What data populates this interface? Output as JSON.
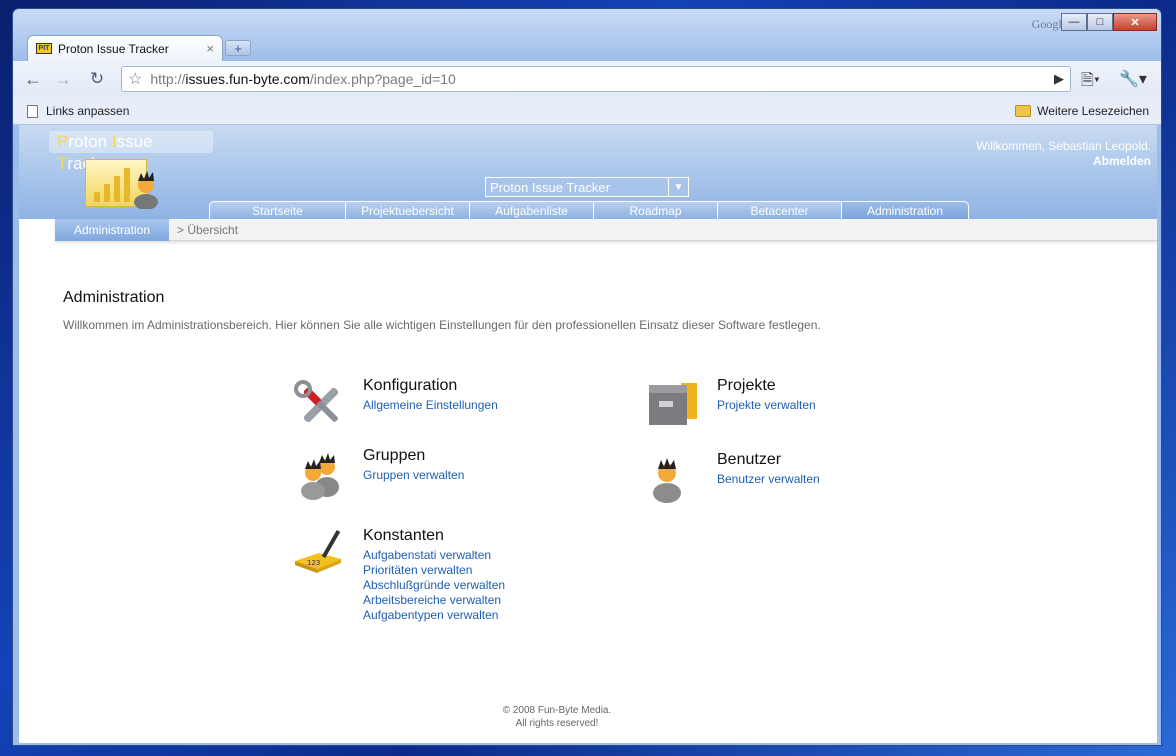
{
  "browser": {
    "tab_title": "Proton Issue Tracker",
    "tab_favicon_text": "PIT",
    "google_label": "Google",
    "url_scheme": "http://",
    "url_host": "issues.fun-byte.com",
    "url_path": "/index.php?page_id=10",
    "bookmark_left": "Links anpassen",
    "bookmark_right": "Weitere Lesezeichen"
  },
  "site": {
    "logo_text_parts": [
      "P",
      "roton ",
      "I",
      "ssue ",
      "T",
      "racker"
    ],
    "welcome": "Willkommen, Sebastian Leopold.",
    "logout": "Abmelden",
    "project_select": "Proton Issue Tracker",
    "nav": [
      "Startseite",
      "Projektuebersicht",
      "Aufgabenliste",
      "Roadmap",
      "Betacenter",
      "Administration"
    ],
    "subnav_active": "Administration",
    "subnav_crumb": "> Übersicht"
  },
  "main": {
    "title": "Administration",
    "description": "Willkommen im Administrationsbereich. Hier können Sie alle wichtigen Einstellungen für den professionellen Einsatz dieser Software festlegen.",
    "sections": {
      "konfiguration": {
        "title": "Konfiguration",
        "links": [
          "Allgemeine Einstellungen"
        ],
        "icon": "tools-icon"
      },
      "projekte": {
        "title": "Projekte",
        "links": [
          "Projekte verwalten"
        ],
        "icon": "cabinet-icon"
      },
      "gruppen": {
        "title": "Gruppen",
        "links": [
          "Gruppen verwalten"
        ],
        "icon": "users-icon"
      },
      "benutzer": {
        "title": "Benutzer",
        "links": [
          "Benutzer verwalten"
        ],
        "icon": "user-icon"
      },
      "konstanten": {
        "title": "Konstanten",
        "links": [
          "Aufgabenstati verwalten",
          "Prioritäten verwalten",
          "Abschlußgründe verwalten",
          "Arbeitsbereiche verwalten",
          "Aufgabentypen verwalten"
        ],
        "icon": "constants-icon"
      }
    }
  },
  "footer": {
    "line1": "© 2008 Fun-Byte Media.",
    "line2": "All rights reserved!"
  }
}
